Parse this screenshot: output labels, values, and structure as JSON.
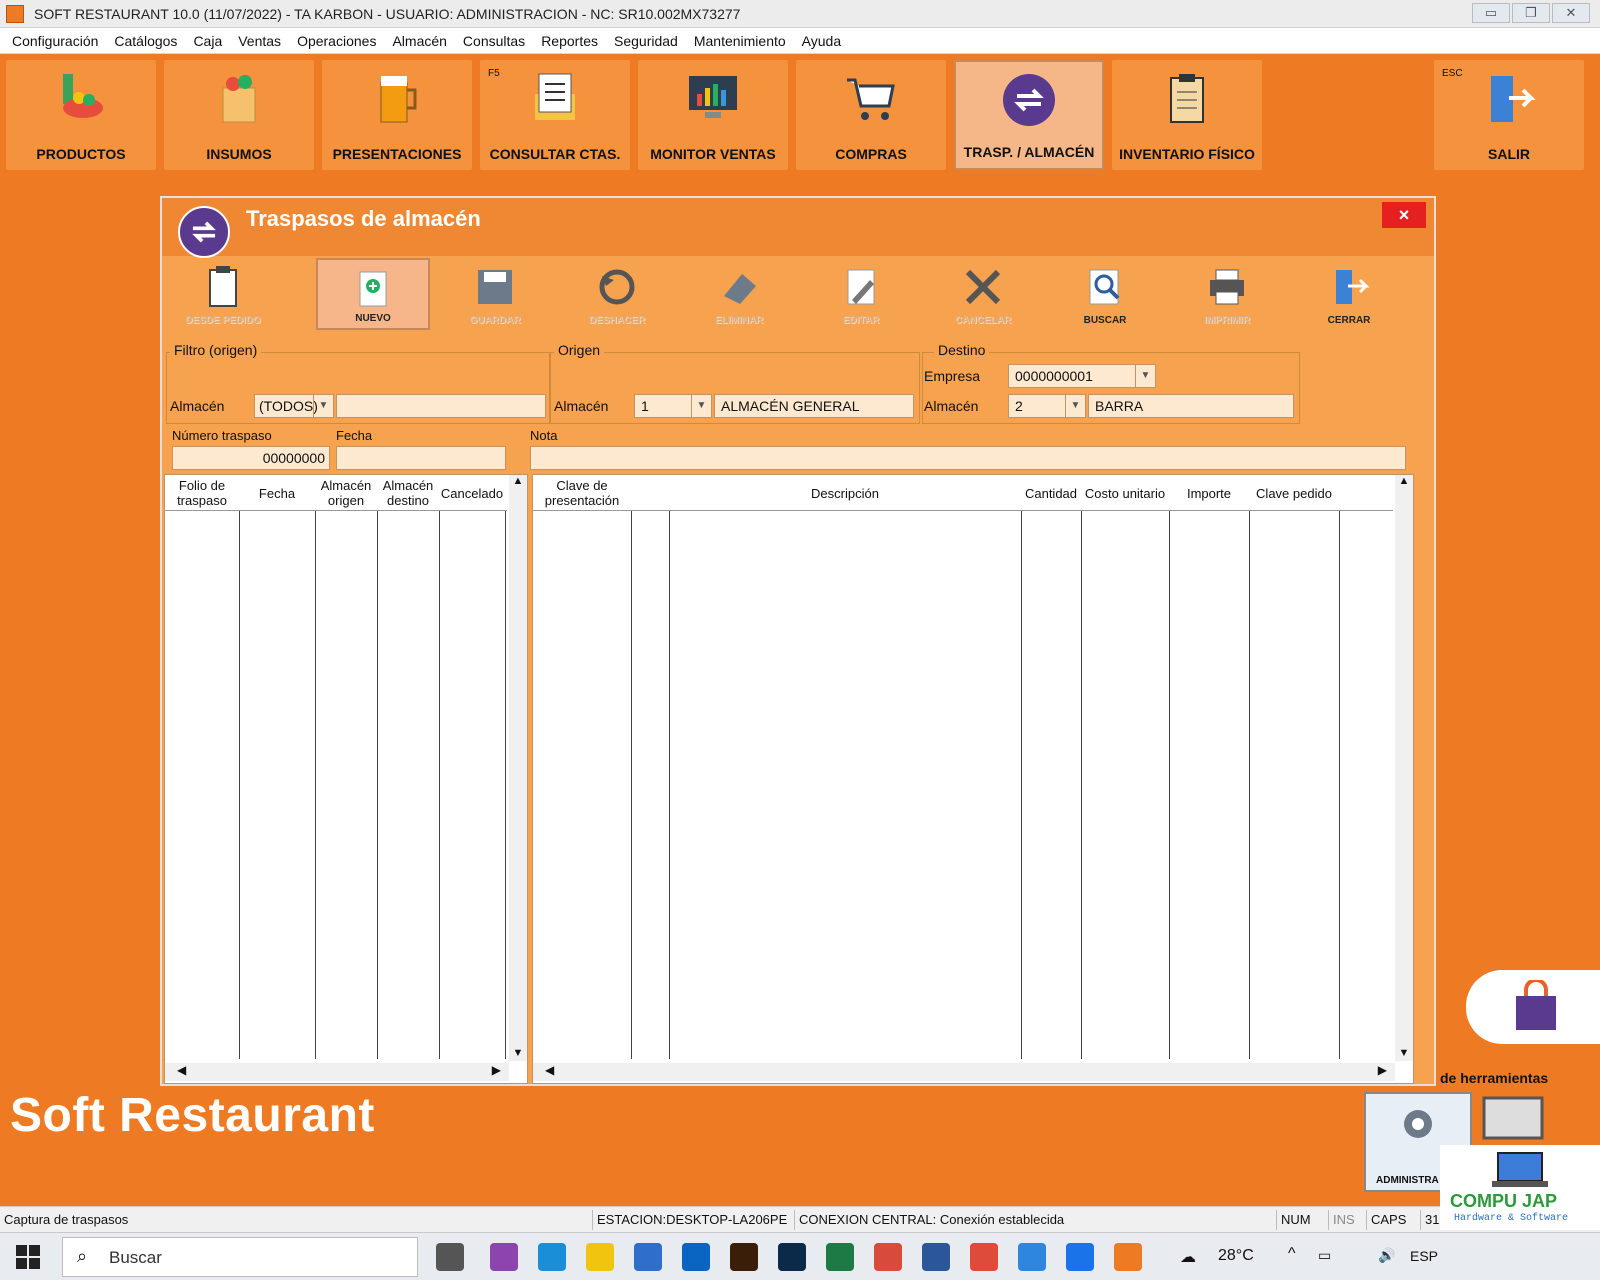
{
  "window": {
    "title": "SOFT RESTAURANT  10.0 (11/07/2022)  -  TA KARBON  -  USUARIO: ADMINISTRACION    -    NC: SR10.002MX73277"
  },
  "menu": [
    "Configuración",
    "Catálogos",
    "Caja",
    "Ventas",
    "Operaciones",
    "Almacén",
    "Consultas",
    "Reportes",
    "Seguridad",
    "Mantenimiento",
    "Ayuda"
  ],
  "toolbar": [
    {
      "label": "PRODUCTOS",
      "icon": "products-icon",
      "key": ""
    },
    {
      "label": "INSUMOS",
      "icon": "groceries-bag-icon",
      "key": ""
    },
    {
      "label": "PRESENTACIONES",
      "icon": "beer-mug-icon",
      "key": ""
    },
    {
      "label": "CONSULTAR CTAS.",
      "icon": "account-document-icon",
      "key": "F5"
    },
    {
      "label": "MONITOR VENTAS",
      "icon": "sales-monitor-icon",
      "key": ""
    },
    {
      "label": "COMPRAS",
      "icon": "shopping-cart-icon",
      "key": ""
    },
    {
      "label": "TRASP. / ALMACÉN",
      "icon": "transfer-icon",
      "key": ""
    },
    {
      "label": "INVENTARIO FÍSICO",
      "icon": "clipboard-icon",
      "key": ""
    },
    {
      "label": "SALIR",
      "icon": "exit-door-icon",
      "key": "ESC"
    }
  ],
  "dialog": {
    "title": "Traspasos de almacén",
    "close": "×",
    "toolbar": [
      {
        "label": "DESDE PEDIDO",
        "icon": "clipboard-icon",
        "state": "disabled"
      },
      {
        "label": "NUEVO",
        "icon": "new-document-icon",
        "state": "selected"
      },
      {
        "label": "GUARDAR",
        "icon": "save-icon",
        "state": "disabled"
      },
      {
        "label": "DESHACER",
        "icon": "undo-icon",
        "state": "disabled"
      },
      {
        "label": "ELIMINAR",
        "icon": "eraser-icon",
        "state": "disabled"
      },
      {
        "label": "EDITAR",
        "icon": "edit-icon",
        "state": "disabled"
      },
      {
        "label": "CANCELAR",
        "icon": "cancel-icon",
        "state": "disabled"
      },
      {
        "label": "BUSCAR",
        "icon": "search-icon",
        "state": "enabled"
      },
      {
        "label": "IMPRIMIR",
        "icon": "printer-icon",
        "state": "disabled"
      },
      {
        "label": "CERRAR",
        "icon": "exit-door-icon",
        "state": "enabled"
      }
    ],
    "filtro": {
      "legend": "Filtro (origen)",
      "almacen_label": "Almacén",
      "almacen_value": "(TODOS)"
    },
    "origen": {
      "legend": "Origen",
      "almacen_label": "Almacén",
      "almacen_code": "1",
      "almacen_name": "ALMACÉN GENERAL"
    },
    "destino": {
      "legend": "Destino",
      "empresa_label": "Empresa",
      "empresa_value": "0000000001",
      "almacen_label": "Almacén",
      "almacen_code": "2",
      "almacen_name": "BARRA"
    },
    "numero_label": "Número traspaso",
    "numero_value": "00000000",
    "fecha_label": "Fecha",
    "fecha_value": "",
    "nota_label": "Nota",
    "nota_value": "",
    "left_grid": {
      "columns": [
        "Folio de traspaso",
        "Fecha",
        "Almacén origen",
        "Almacén destino",
        "Cancelado"
      ]
    },
    "right_grid": {
      "columns": [
        "Clave de presentación",
        "",
        "Descripción",
        "Cantidad",
        "Costo unitario",
        "Importe",
        "Clave pedido"
      ]
    }
  },
  "brand": "Soft Restaurant",
  "side": {
    "herramientas": "de herramientas",
    "admin": "ADMINISTRA"
  },
  "status": {
    "left": "Captura de traspasos",
    "estacion": "ESTACION:DESKTOP-LA206PE",
    "conexion": "CONEXION CENTRAL:  Conexión establecida",
    "num": "NUM",
    "ins": "INS",
    "caps": "CAPS",
    "date": "31."
  },
  "taskbar": {
    "search": "Buscar",
    "temp": "28°C",
    "lang": "ESP"
  },
  "compujap": {
    "name": "COMPU JAP",
    "sub": "Hardware  &  Software"
  },
  "colors": {
    "accent": "#ef7a24",
    "dialog": "#f6a24f",
    "purple": "#5a3a8e",
    "close": "#e52020"
  }
}
